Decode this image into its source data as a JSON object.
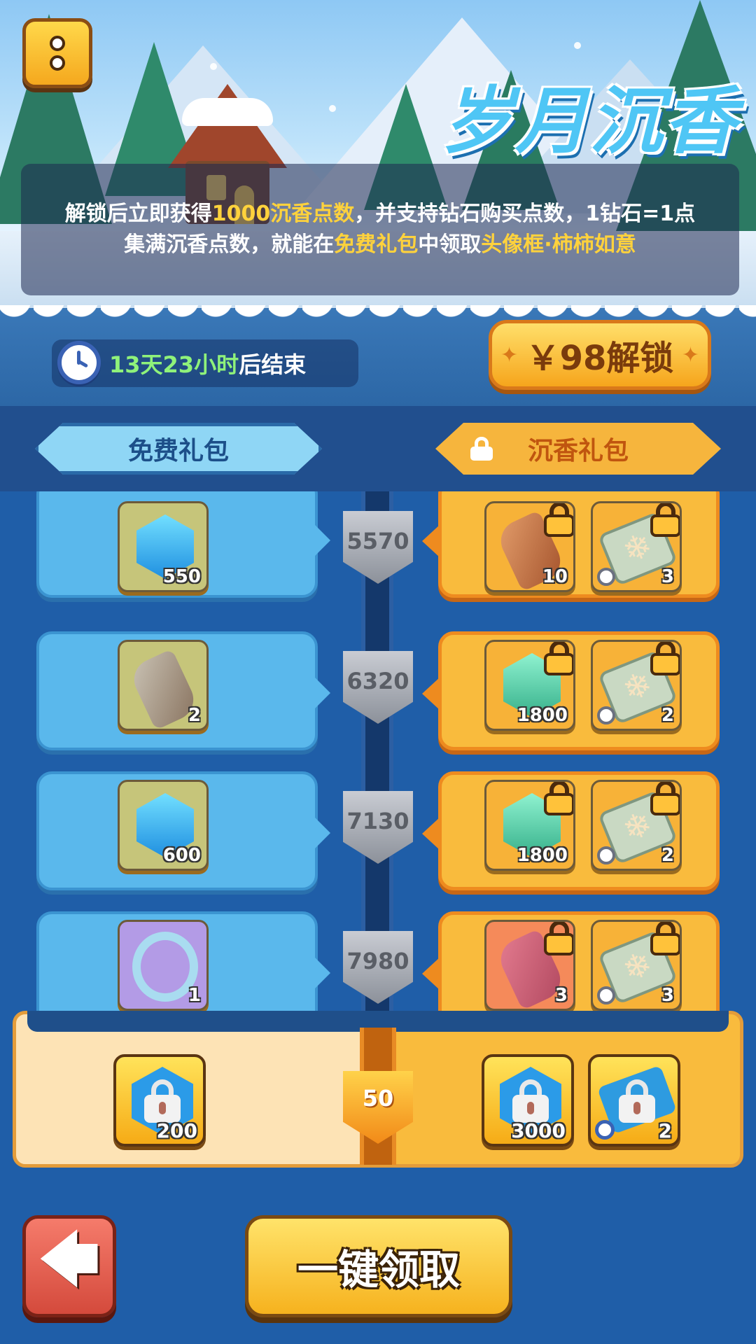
{
  "event": {
    "title": "岁月沉香",
    "desc_line1": [
      "解锁后立即获得",
      "1000沉香点数",
      "，并支持钻石购买点数，1钻石=1点"
    ],
    "desc_line2": [
      "集满沉香点数，就能在",
      "免费礼包",
      "中领取",
      "头像框·柿柿如意"
    ],
    "timer": {
      "green": "13天23小时",
      "suffix": "后结束"
    },
    "unlock_label": "￥98解锁"
  },
  "tabs": {
    "free": "免费礼包",
    "premium": "沉香礼包"
  },
  "rows": [
    {
      "points": "5570",
      "free": {
        "icon": "blue-gem-icon",
        "qty": "550"
      },
      "premium": [
        {
          "icon": "orange-scroll-icon",
          "qty": "10"
        },
        {
          "icon": "snowflake-ticket-icon",
          "qty": "3"
        }
      ]
    },
    {
      "points": "6320",
      "free": {
        "icon": "grey-scroll-icon",
        "qty": "2"
      },
      "premium": [
        {
          "icon": "green-gem-icon",
          "qty": "1800"
        },
        {
          "icon": "snowflake-ticket-icon",
          "qty": "2"
        }
      ]
    },
    {
      "points": "7130",
      "free": {
        "icon": "blue-gem-icon",
        "qty": "600"
      },
      "premium": [
        {
          "icon": "green-gem-icon",
          "qty": "1800"
        },
        {
          "icon": "snowflake-ticket-icon",
          "qty": "2"
        }
      ]
    },
    {
      "points": "7980",
      "free": {
        "icon": "avatar-frame-icon",
        "qty": "1"
      },
      "premium": [
        {
          "icon": "pink-scroll-icon",
          "qty": "3"
        },
        {
          "icon": "snowflake-ticket-icon",
          "qty": "3"
        }
      ]
    }
  ],
  "final": {
    "level": "50",
    "free_qty": "200",
    "premium_qty1": "3000",
    "premium_qty2": "2"
  },
  "buttons": {
    "back": "🡄",
    "claim_all": "一键领取"
  }
}
